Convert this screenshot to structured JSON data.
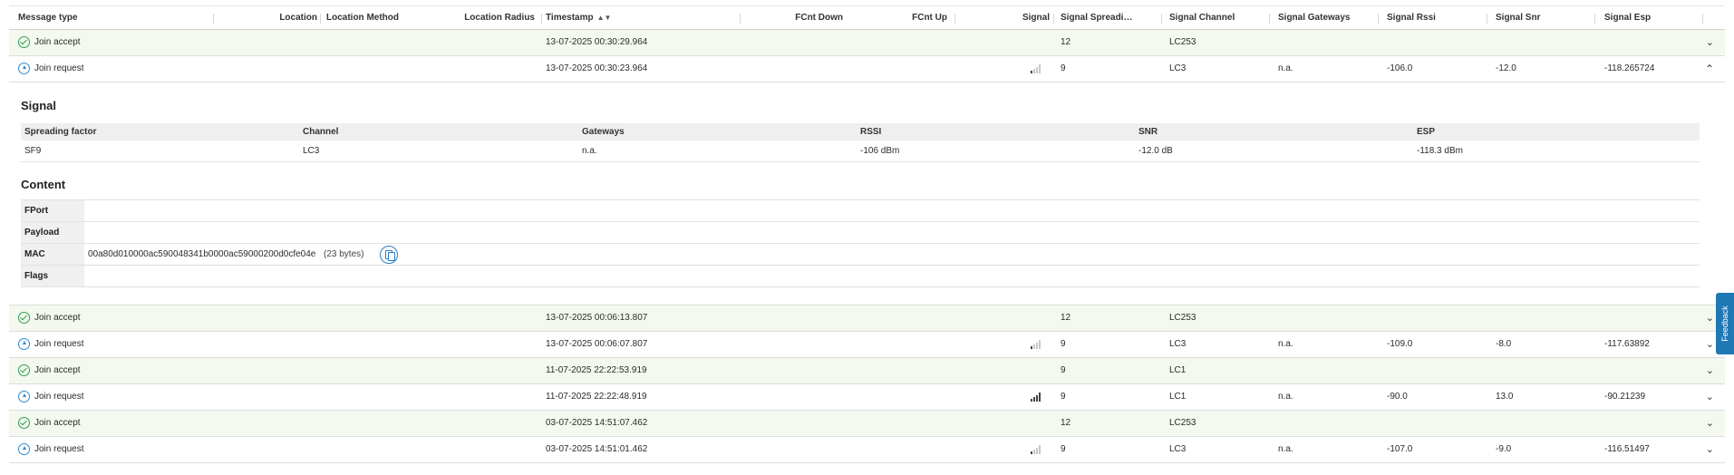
{
  "table": {
    "columns": [
      {
        "key": "message_type",
        "label": "Message type"
      },
      {
        "key": "location",
        "label": "Location"
      },
      {
        "key": "location_method",
        "label": "Location Method"
      },
      {
        "key": "location_radius",
        "label": "Location Radius"
      },
      {
        "key": "timestamp",
        "label": "Timestamp"
      },
      {
        "key": "fcnt_down",
        "label": "FCnt Down"
      },
      {
        "key": "fcnt_up",
        "label": "FCnt Up"
      },
      {
        "key": "signal",
        "label": "Signal"
      },
      {
        "key": "signal_spreading",
        "label": "Signal Spreading ..."
      },
      {
        "key": "signal_channel",
        "label": "Signal Channel"
      },
      {
        "key": "signal_gateways",
        "label": "Signal Gateways"
      },
      {
        "key": "signal_rssi",
        "label": "Signal Rssi"
      },
      {
        "key": "signal_snr",
        "label": "Signal Snr"
      },
      {
        "key": "signal_esp",
        "label": "Signal Esp"
      }
    ],
    "sort_icon": "sort-desc-icon",
    "rows": [
      {
        "type": "Join accept",
        "status_icon": "check-circle-icon",
        "timestamp": "13-07-2025 00:30:29.964",
        "signal_bars": 0,
        "spreading": "12",
        "channel": "LC253",
        "gateways": "",
        "rssi": "",
        "snr": "",
        "esp": "",
        "expanded": false
      },
      {
        "type": "Join request",
        "status_icon": "arrow-up-circle-icon",
        "timestamp": "13-07-2025 00:30:23.964",
        "signal_bars": 1,
        "spreading": "9",
        "channel": "LC3",
        "gateways": "n.a.",
        "rssi": "-106.0",
        "snr": "-12.0",
        "esp": "-118.265724",
        "expanded": true
      },
      {
        "type": "Join accept",
        "status_icon": "check-circle-icon",
        "timestamp": "13-07-2025 00:06:13.807",
        "signal_bars": 0,
        "spreading": "12",
        "channel": "LC253",
        "gateways": "",
        "rssi": "",
        "snr": "",
        "esp": "",
        "expanded": false
      },
      {
        "type": "Join request",
        "status_icon": "arrow-up-circle-icon",
        "timestamp": "13-07-2025 00:06:07.807",
        "signal_bars": 1,
        "spreading": "9",
        "channel": "LC3",
        "gateways": "n.a.",
        "rssi": "-109.0",
        "snr": "-8.0",
        "esp": "-117.63892",
        "expanded": false
      },
      {
        "type": "Join accept",
        "status_icon": "check-circle-icon",
        "timestamp": "11-07-2025 22:22:53.919",
        "signal_bars": 0,
        "spreading": "9",
        "channel": "LC1",
        "gateways": "",
        "rssi": "",
        "snr": "",
        "esp": "",
        "expanded": false
      },
      {
        "type": "Join request",
        "status_icon": "arrow-up-circle-icon",
        "timestamp": "11-07-2025 22:22:48.919",
        "signal_bars": 4,
        "spreading": "9",
        "channel": "LC1",
        "gateways": "n.a.",
        "rssi": "-90.0",
        "snr": "13.0",
        "esp": "-90.21239",
        "expanded": false
      },
      {
        "type": "Join accept",
        "status_icon": "check-circle-icon",
        "timestamp": "03-07-2025 14:51:07.462",
        "signal_bars": 0,
        "spreading": "12",
        "channel": "LC253",
        "gateways": "",
        "rssi": "",
        "snr": "",
        "esp": "",
        "expanded": false
      },
      {
        "type": "Join request",
        "status_icon": "arrow-up-circle-icon",
        "timestamp": "03-07-2025 14:51:01.462",
        "signal_bars": 1,
        "spreading": "9",
        "channel": "LC3",
        "gateways": "n.a.",
        "rssi": "-107.0",
        "snr": "-9.0",
        "esp": "-116.51497",
        "expanded": false
      }
    ]
  },
  "detail": {
    "signal_title": "Signal",
    "signal_headers": [
      "Spreading factor",
      "Channel",
      "Gateways",
      "RSSI",
      "SNR",
      "ESP"
    ],
    "signal_values": [
      "SF9",
      "LC3",
      "n.a.",
      "-106 dBm",
      "-12.0 dB",
      "-118.3 dBm"
    ],
    "content_title": "Content",
    "content_rows": [
      {
        "label": "FPort",
        "value": ""
      },
      {
        "label": "Payload",
        "value": ""
      },
      {
        "label": "MAC",
        "value": "00a80d010000ac590048341b0000ac59000200d0cfe04e",
        "bytes": "(23 bytes)"
      },
      {
        "label": "Flags",
        "value": ""
      }
    ],
    "copy_icon": "copy-icon"
  },
  "icons": {
    "expand": "chevron-down-icon",
    "collapse": "chevron-up-icon"
  },
  "colors": {
    "accept_row_bg": "#f3f9ef",
    "accept_icon": "#2e9e48",
    "request_icon": "#2b8bd0",
    "feedback_bg": "#1f78b4"
  },
  "feedback": {
    "label": "Feedback"
  }
}
